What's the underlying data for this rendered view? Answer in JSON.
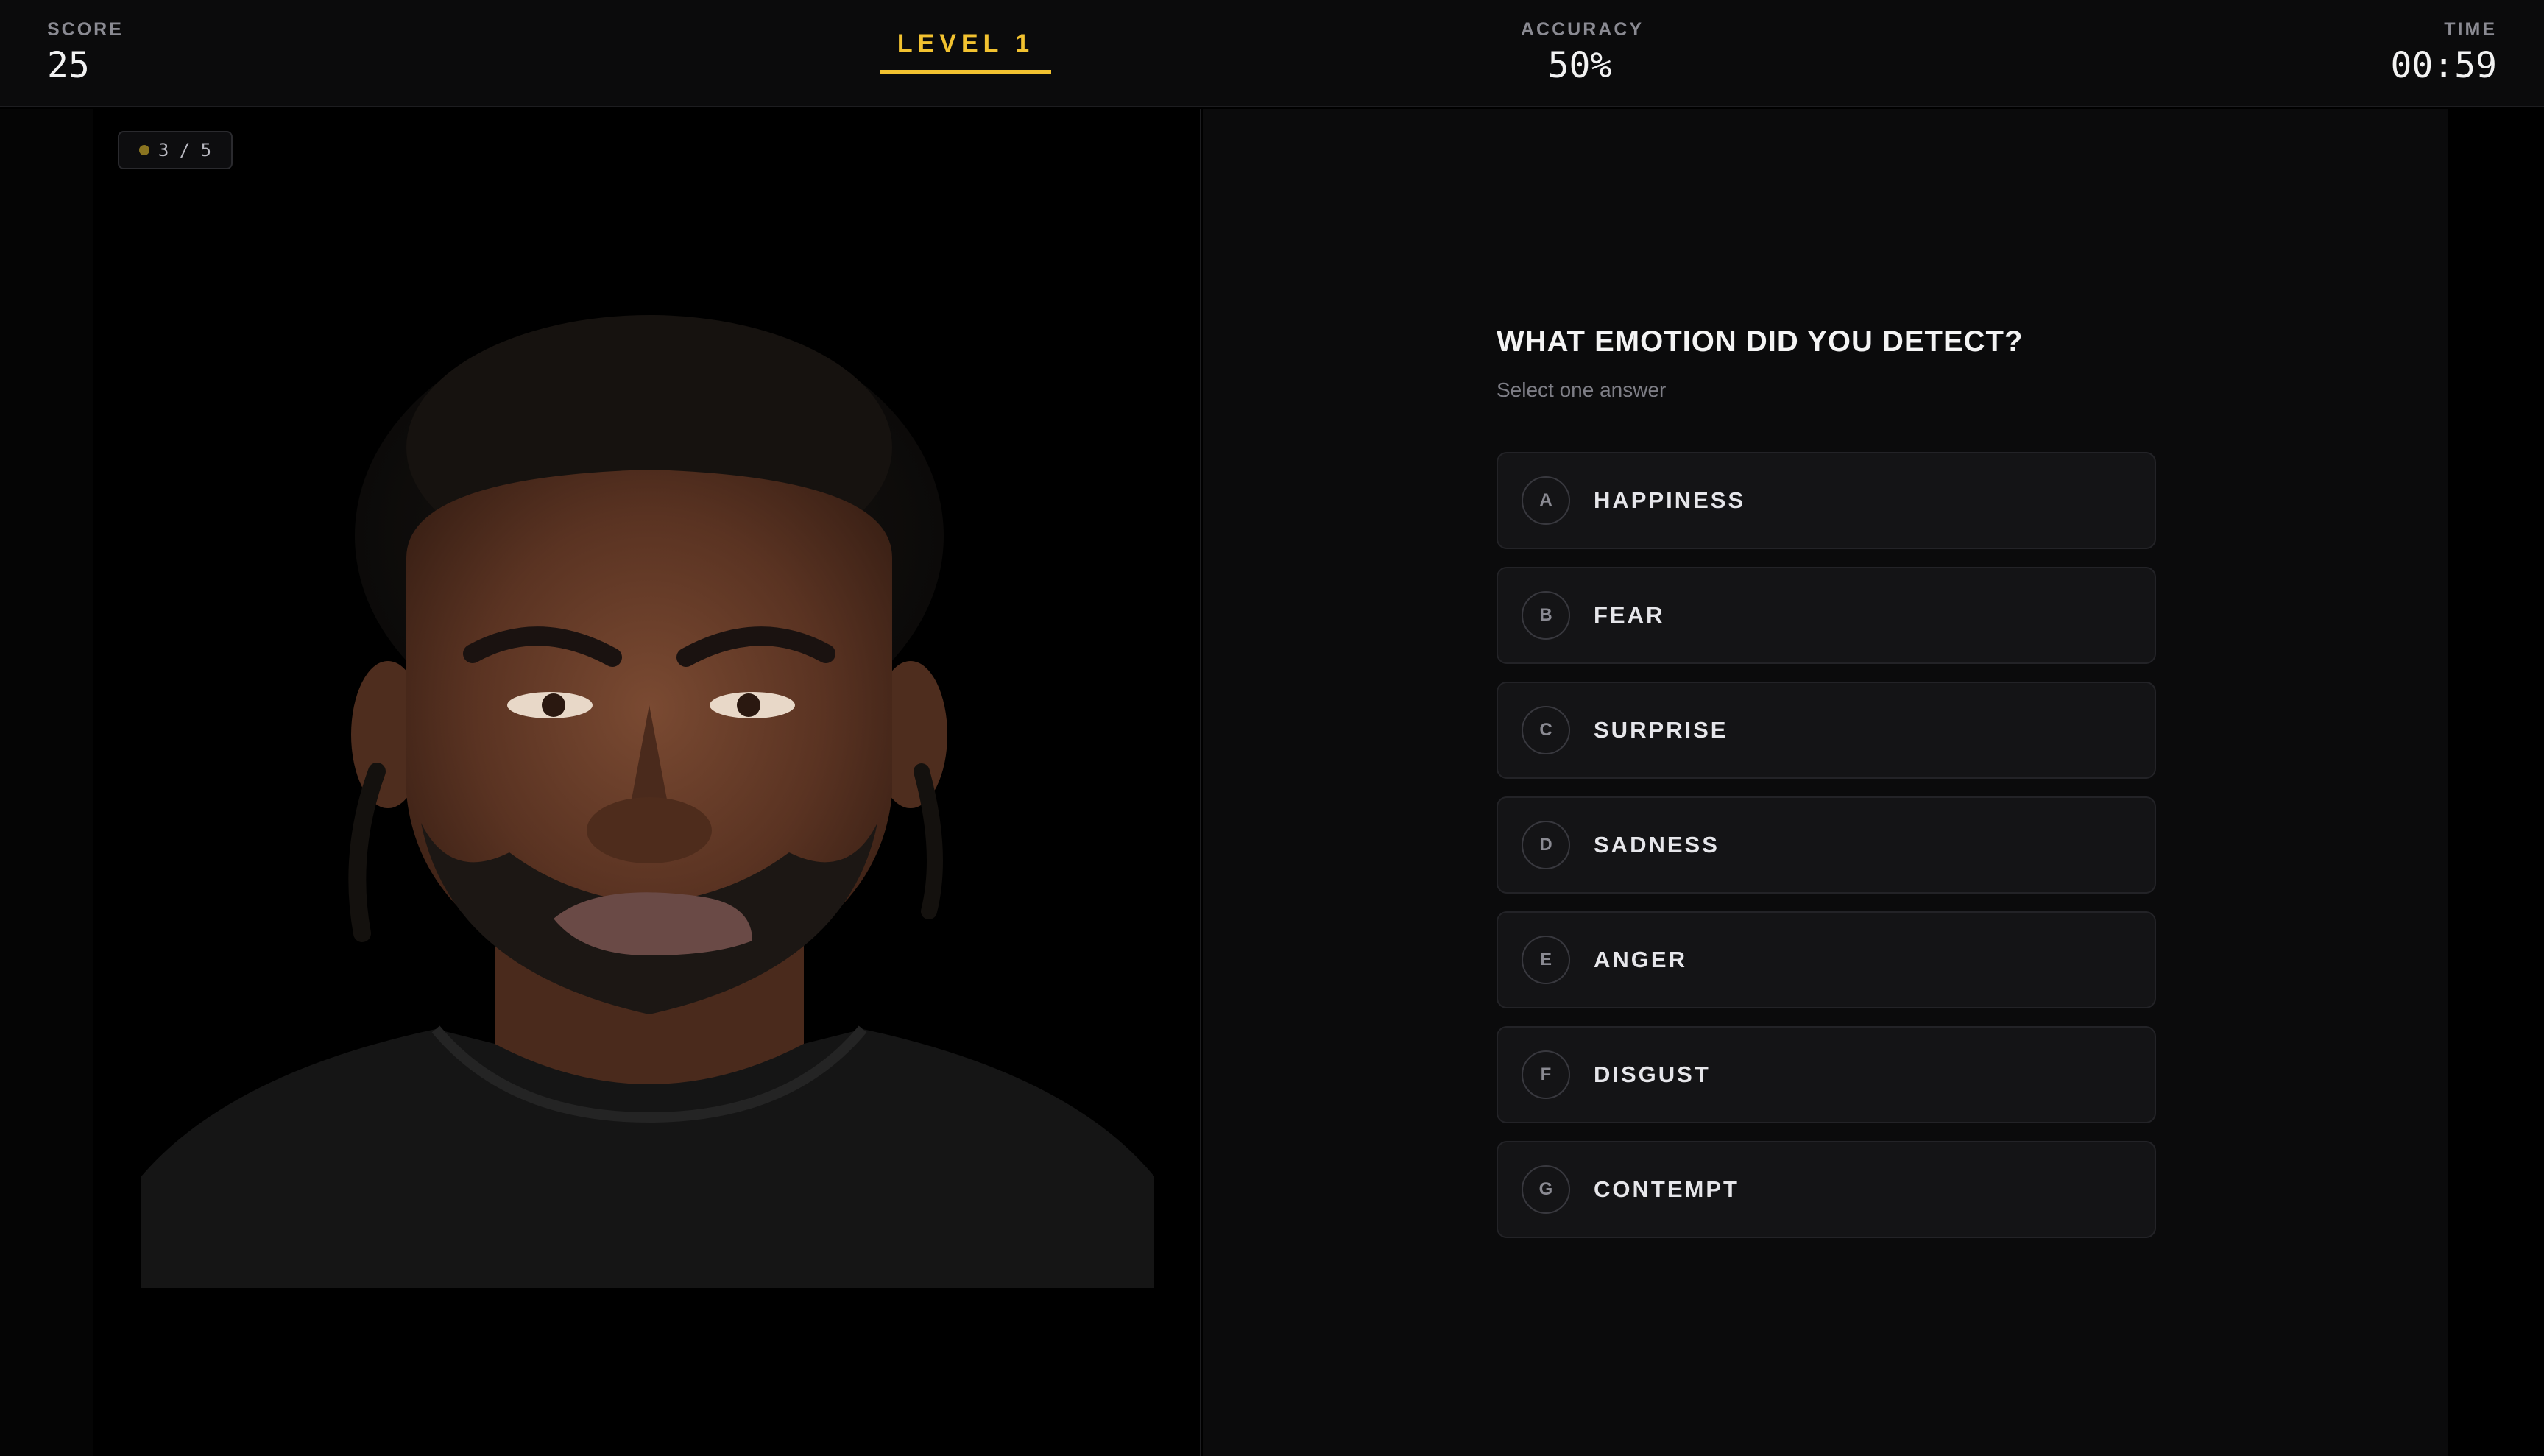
{
  "header": {
    "score_label": "SCORE",
    "score_value": "25",
    "level_label": "LEVEL 1",
    "accuracy_label": "ACCURACY",
    "accuracy_value": "50%",
    "time_label": "TIME",
    "time_value": "00:59"
  },
  "progress": {
    "text": "3 / 5"
  },
  "quiz": {
    "question": "WHAT EMOTION DID YOU DETECT?",
    "hint": "Select one answer",
    "options": [
      {
        "key": "A",
        "label": "HAPPINESS"
      },
      {
        "key": "B",
        "label": "FEAR"
      },
      {
        "key": "C",
        "label": "SURPRISE"
      },
      {
        "key": "D",
        "label": "SADNESS"
      },
      {
        "key": "E",
        "label": "ANGER"
      },
      {
        "key": "F",
        "label": "DISGUST"
      },
      {
        "key": "G",
        "label": "CONTEMPT"
      }
    ]
  },
  "colors": {
    "accent": "#f2c230",
    "background": "#000000",
    "panel": "#0b0b0c",
    "option_bg": "#141416"
  }
}
